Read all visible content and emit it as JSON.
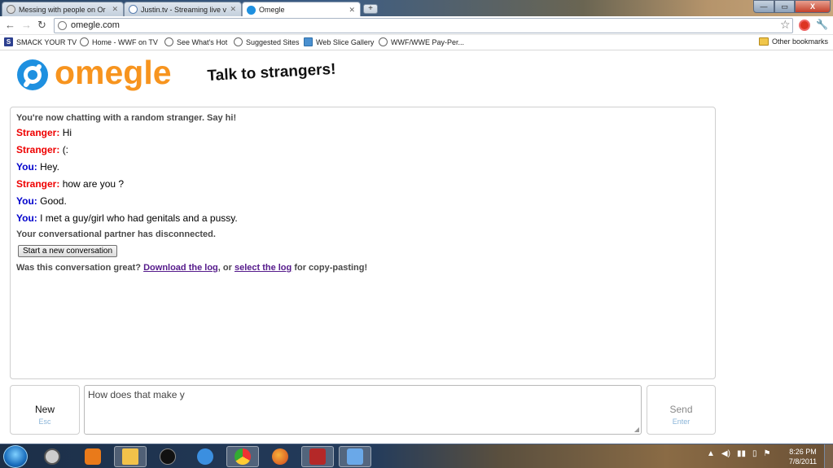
{
  "browser": {
    "tabs": [
      {
        "label": "Messing with people on Or",
        "active": false
      },
      {
        "label": "Justin.tv - Streaming live vi",
        "active": false
      },
      {
        "label": "Omegle",
        "active": true
      }
    ],
    "new_tab_symbol": "+",
    "window_controls": {
      "minimize": "—",
      "maximize": "▭",
      "close": "X"
    },
    "address": "omegle.com",
    "bookmarks": [
      {
        "label": "SMACK YOUR TV",
        "icon": "smack-icon"
      },
      {
        "label": "Home - WWF on TV",
        "icon": "globe-icon"
      },
      {
        "label": "See What's Hot",
        "icon": "globe-icon"
      },
      {
        "label": "Suggested Sites",
        "icon": "globe-icon"
      },
      {
        "label": "Web Slice Gallery",
        "icon": "webslice-icon"
      },
      {
        "label": "WWF/WWE Pay-Per...",
        "icon": "globe-icon"
      }
    ],
    "other_bookmarks": "Other bookmarks"
  },
  "site": {
    "logo_text": "omegle",
    "tagline": "Talk to strangers!",
    "colors": {
      "logo_orange": "#f7941e",
      "logo_blue": "#1e90e0",
      "stranger": "#ee0000",
      "you": "#0000cc"
    }
  },
  "chat": {
    "intro": "You're now chatting with a random stranger. Say hi!",
    "messages": [
      {
        "who": "Stranger:",
        "side": "stranger",
        "text": "Hi"
      },
      {
        "who": "Stranger:",
        "side": "stranger",
        "text": "(:"
      },
      {
        "who": "You:",
        "side": "you",
        "text": "Hey."
      },
      {
        "who": "Stranger:",
        "side": "stranger",
        "text": "how are you ?"
      },
      {
        "who": "You:",
        "side": "you",
        "text": "Good."
      },
      {
        "who": "You:",
        "side": "you",
        "text": "I met a guy/girl who had genitals and a pussy."
      }
    ],
    "disconnected": "Your conversational partner has disconnected.",
    "new_conversation_button": "Start a new conversation",
    "log_prefix": "Was this conversation great?",
    "download_link": "Download the log",
    "log_middle": ", or",
    "select_link": "select the log",
    "log_suffix": "for copy-pasting!"
  },
  "controls": {
    "new_label": "New",
    "new_hint": "Esc",
    "message_value": "How does that make y",
    "send_label": "Send",
    "send_hint": "Enter"
  },
  "taskbar": {
    "apps": [
      "media-center-icon",
      "media-player-icon",
      "explorer-icon",
      "hp-icon",
      "ie-icon",
      "chrome-icon",
      "firefox-icon",
      "pj-icon",
      "paint-icon"
    ],
    "time": "8:26 PM",
    "date": "7/8/2011"
  }
}
